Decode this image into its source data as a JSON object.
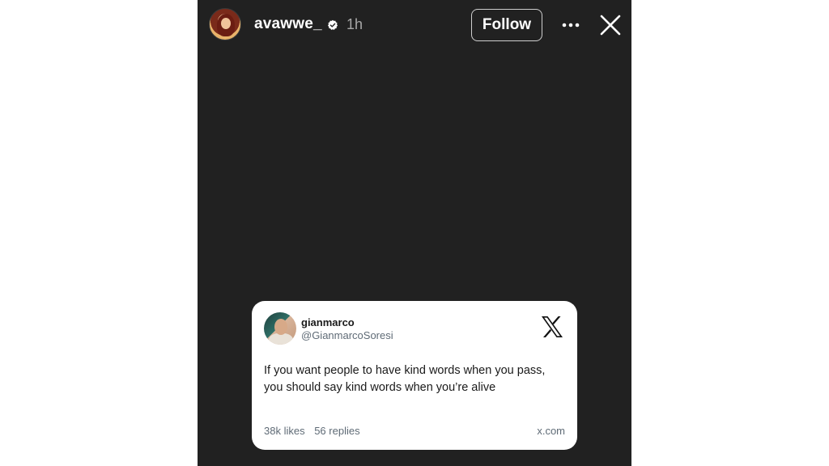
{
  "story": {
    "username": "avawwe_",
    "time_ago": "1h",
    "follow_label": "Follow",
    "background_color": "#212121"
  },
  "icons": {
    "verified": "verified-badge-icon",
    "more": "more-options-icon",
    "close": "close-icon",
    "x_logo": "x-logo-icon"
  },
  "tweet": {
    "display_name": "gianmarco",
    "handle": "@GianmarcoSoresi",
    "text_line1": "If you want people to have kind words when you pass,",
    "text_line2": "you should say kind words when you’re alive",
    "likes": "38k likes",
    "replies": "56 replies",
    "source": "x.com"
  }
}
